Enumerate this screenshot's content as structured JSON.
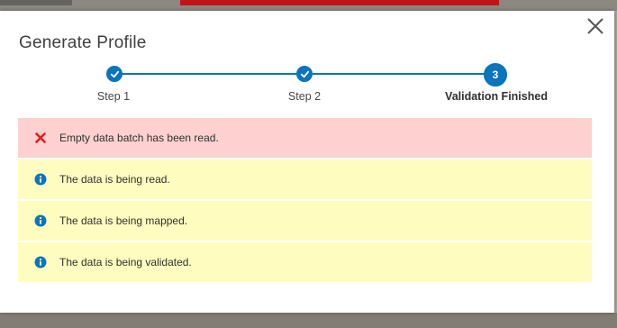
{
  "dialog": {
    "title": "Generate Profile"
  },
  "stepper": {
    "steps": [
      {
        "label": "Step 1",
        "state": "done"
      },
      {
        "label": "Step 2",
        "state": "done"
      },
      {
        "label": "Validation Finished",
        "state": "active",
        "number": "3"
      }
    ]
  },
  "messages": [
    {
      "type": "error",
      "icon": "x-icon",
      "text": "Empty data batch has been read."
    },
    {
      "type": "info",
      "icon": "info-icon",
      "text": "The data is being read."
    },
    {
      "type": "info",
      "icon": "info-icon",
      "text": "The data is being mapped."
    },
    {
      "type": "info",
      "icon": "info-icon",
      "text": "The data is being validated."
    }
  ],
  "colors": {
    "accent": "#0a74bd",
    "error_bg": "#ffd0d0",
    "info_bg": "#fefdbf",
    "error_icon": "#e02020",
    "info_icon": "#0a74bd"
  }
}
